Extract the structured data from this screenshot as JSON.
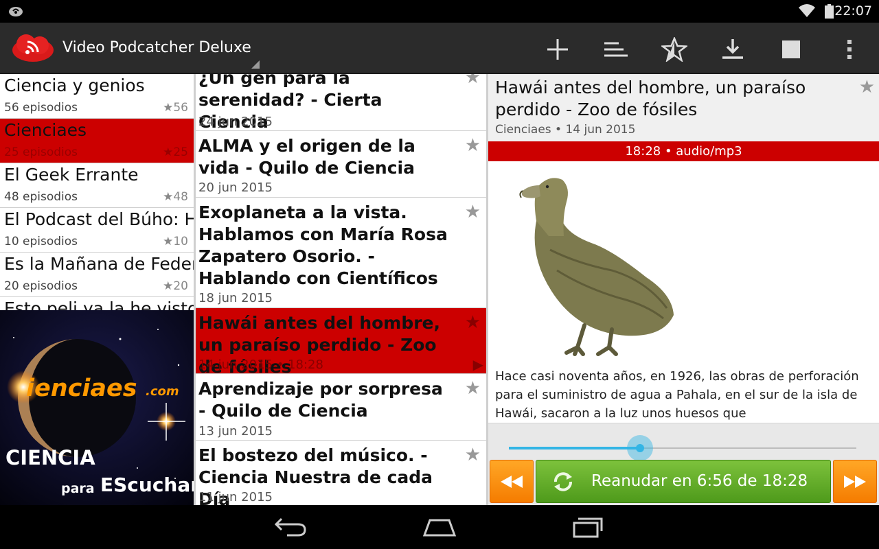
{
  "status_bar": {
    "time": "22:07",
    "icons": [
      "notification-icon",
      "wifi-icon",
      "battery-icon"
    ]
  },
  "action_bar": {
    "app_title": "Video Podcatcher Deluxe",
    "actions": [
      "add-icon",
      "sort-icon",
      "star-burst-icon",
      "download-icon",
      "stop-icon",
      "overflow-menu-icon"
    ]
  },
  "podcasts": [
    {
      "name": "Ciencia y genios",
      "count_label": "56 episodios",
      "star_count": "★56",
      "selected": false
    },
    {
      "name": "Cienciaes",
      "count_label": "25 episodios",
      "star_count": "★25",
      "selected": true
    },
    {
      "name": "El Geek Errante",
      "count_label": "48 episodios",
      "star_count": "★48",
      "selected": false
    },
    {
      "name": "El Podcast del Búho: H",
      "count_label": "10 episodios",
      "star_count": "★10",
      "selected": false
    },
    {
      "name": "Es la Mañana de Feder",
      "count_label": "20 episodios",
      "star_count": "★20",
      "selected": false
    },
    {
      "name": "Esto peli ya la he visto",
      "count_label": "",
      "star_count": "",
      "selected": false
    }
  ],
  "artwork": {
    "text_ies": "ienciaes",
    "text_com": ".com",
    "text_ciencia": "CIENCIA",
    "text_para": "para",
    "text_escuchar": "EScuchar"
  },
  "episodes": [
    {
      "title": "¿Un gen para la serenidad? - Cierta Ciencia",
      "date": "24 jun 2015",
      "selected": false
    },
    {
      "title": "ALMA y el origen de la vida - Quilo de Ciencia",
      "date": "20 jun 2015",
      "selected": false
    },
    {
      "title": "Exoplaneta a la vista. Hablamos con María Rosa Zapatero Osorio. - Hablando con Científicos",
      "date": "18 jun 2015",
      "selected": false
    },
    {
      "title": "Hawái antes del hombre, un paraíso perdido - Zoo de fósiles",
      "date": "14 jun 2015 • 18:28",
      "selected": true
    },
    {
      "title": "Aprendizaje por sorpresa - Quilo de Ciencia",
      "date": "13 jun 2015",
      "selected": false
    },
    {
      "title": "El bostezo del músico. - Ciencia Nuestra de cada Día",
      "date": "11 jun 2015",
      "selected": false
    }
  ],
  "detail": {
    "title": "Hawái antes del hombre, un paraíso perdido - Zoo de fósiles",
    "subtitle": "Cienciaes • 14 jun 2015",
    "media_info": "18:28 • audio/mp3",
    "description": "Hace casi noventa años, en 1926, las obras de perforación para el suministro de agua a Pahala, en el sur de la isla de Hawái, sacaron a la luz unos huesos que",
    "progress_fraction": 0.377,
    "resume_label": "Reanudar en 6:56 de 18:28"
  },
  "nav_bar": {
    "icons": [
      "back-icon",
      "home-icon",
      "recents-icon"
    ]
  },
  "colors": {
    "accent": "#cc0000",
    "actionbar": "#2b2b2b",
    "seek": "#33b5e5",
    "resume": "#5fa82a",
    "skip": "#f68b1f"
  }
}
